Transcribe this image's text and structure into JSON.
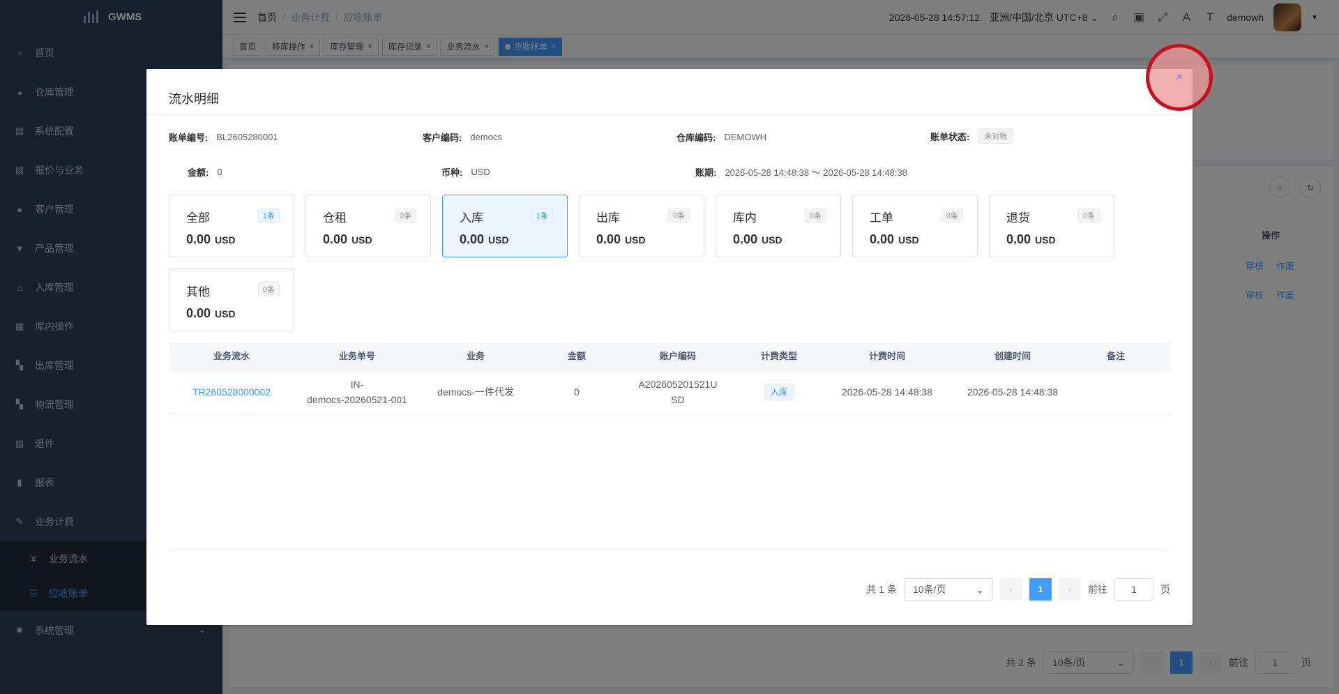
{
  "sidebar": {
    "logo_text": "GWMS",
    "items": [
      {
        "label": "首页",
        "icon": "dashboard-icon"
      },
      {
        "label": "仓库管理",
        "icon": "globe-icon"
      },
      {
        "label": "系统配置",
        "icon": "document-icon"
      },
      {
        "label": "报价与业务",
        "icon": "clipboard-icon"
      },
      {
        "label": "客户管理",
        "icon": "user-icon"
      },
      {
        "label": "产品管理",
        "icon": "cart-icon"
      },
      {
        "label": "入库管理",
        "icon": "home-icon"
      },
      {
        "label": "库内操作",
        "icon": "table-icon"
      },
      {
        "label": "出库管理",
        "icon": "grid-icon"
      },
      {
        "label": "物流管理",
        "icon": "grid-icon"
      },
      {
        "label": "退件",
        "icon": "clipboard-icon"
      },
      {
        "label": "报表",
        "icon": "chart-icon"
      },
      {
        "label": "业务计费",
        "icon": "edit-icon"
      }
    ],
    "subitems": [
      {
        "label": "业务流水",
        "icon": "yen-icon"
      },
      {
        "label": "应收账单",
        "icon": "list-icon"
      }
    ],
    "last_item": {
      "label": "系统管理",
      "icon": "gear-icon"
    }
  },
  "navbar": {
    "breadcrumb": [
      "首页",
      "业务计费",
      "应收账单"
    ],
    "datetime": "2026-05-28 14:57:12",
    "timezone": "亚洲/中国/北京 UTC+8",
    "username": "demowh"
  },
  "tags": [
    {
      "label": "首页",
      "closable": false
    },
    {
      "label": "移库操作",
      "closable": true
    },
    {
      "label": "库存管理",
      "closable": true
    },
    {
      "label": "库存记录",
      "closable": true
    },
    {
      "label": "业务流水",
      "closable": true
    },
    {
      "label": "应收账单",
      "closable": true,
      "active": true
    }
  ],
  "background": {
    "column_header": "操作",
    "actions": [
      "审核",
      "作废"
    ],
    "total": "共 2 条",
    "page_size": "10条/页",
    "page": "1",
    "goto": "前往",
    "goto_value": "1",
    "page_unit": "页"
  },
  "dialog": {
    "title": "流水明细",
    "close": "×",
    "info": {
      "bill_no_label": "账单编号:",
      "bill_no": "BL2605280001",
      "customer_label": "客户编码:",
      "customer": "democs",
      "warehouse_label": "仓库编码:",
      "warehouse": "DEMOWH",
      "status_label": "账单状态:",
      "status": "未对账",
      "amount_label": "金额:",
      "amount": "0",
      "currency_label": "币种:",
      "currency": "USD",
      "period_label": "账期:",
      "period": "2026-05-28 14:48:38 ～ 2026-05-28 14:48:38"
    },
    "cards": [
      {
        "name": "全部",
        "count": "1条",
        "amount": "0.00",
        "currency": "USD"
      },
      {
        "name": "仓租",
        "count": "0条",
        "amount": "0.00",
        "currency": "USD"
      },
      {
        "name": "入库",
        "count": "1条",
        "amount": "0.00",
        "currency": "USD"
      },
      {
        "name": "出库",
        "count": "0条",
        "amount": "0.00",
        "currency": "USD"
      },
      {
        "name": "库内",
        "count": "0条",
        "amount": "0.00",
        "currency": "USD"
      },
      {
        "name": "工单",
        "count": "0条",
        "amount": "0.00",
        "currency": "USD"
      },
      {
        "name": "退货",
        "count": "0条",
        "amount": "0.00",
        "currency": "USD"
      },
      {
        "name": "其他",
        "count": "0条",
        "amount": "0.00",
        "currency": "USD"
      }
    ],
    "table": {
      "headers": [
        "业务流水",
        "业务单号",
        "业务",
        "金额",
        "账户编码",
        "计费类型",
        "计费时间",
        "创建时间",
        "备注"
      ],
      "rows": [
        {
          "flow_no": "TR260528000002",
          "order_no_1": "IN-",
          "order_no_2": "democs-20260521-001",
          "business": "democs-一件代发",
          "amount": "0",
          "account_1": "A202605201521U",
          "account_2": "SD",
          "fee_type": "入库",
          "fee_time": "2026-05-28 14:48:38",
          "created": "2026-05-28 14:48:38",
          "remark": ""
        }
      ]
    },
    "pagination": {
      "total": "共 1 条",
      "page_size": "10条/页",
      "page": "1",
      "goto": "前往",
      "goto_value": "1",
      "page_unit": "页"
    }
  },
  "colors": {
    "sidebar_bg": "#304156",
    "accent": "#409eff",
    "close_ring": "#c8101c"
  }
}
